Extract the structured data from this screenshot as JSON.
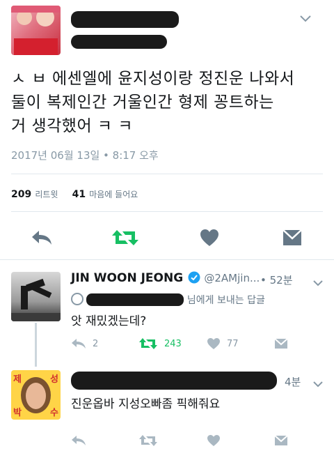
{
  "tweet": {
    "text_line1": "ㅅ ㅂ 에센엘에 윤지성이랑 정진운 나와서",
    "text_line2": "둘이 복제인간 거울인간 형제 꽁트하는",
    "text_line3": "거 생각했어 ㅋ ㅋ",
    "timestamp": "2017년 06월 13일 • 8:17 오후",
    "retweet_count": "209",
    "retweet_label": "리트윗",
    "like_count": "41",
    "like_label": "마음에 들어요"
  },
  "reply1": {
    "name": "JIN WOON JEONG",
    "handle": "@2AMjin...",
    "time": "• 52분",
    "reply_to_suffix": "님에게 보내는 답글",
    "text": "앗 재밌겠는데?",
    "reply_count": "2",
    "retweet_count": "243",
    "like_count": "77"
  },
  "reply2": {
    "time": "4분",
    "text": "진운옵바 지성오빠좀 픽해줘요",
    "avatar_chars": [
      "제",
      "성",
      "박",
      "수"
    ]
  },
  "colors": {
    "retweet_green": "#17bf63",
    "icon_gray": "#657786",
    "muted": "#8899a6",
    "verified_blue": "#1da1f2"
  }
}
